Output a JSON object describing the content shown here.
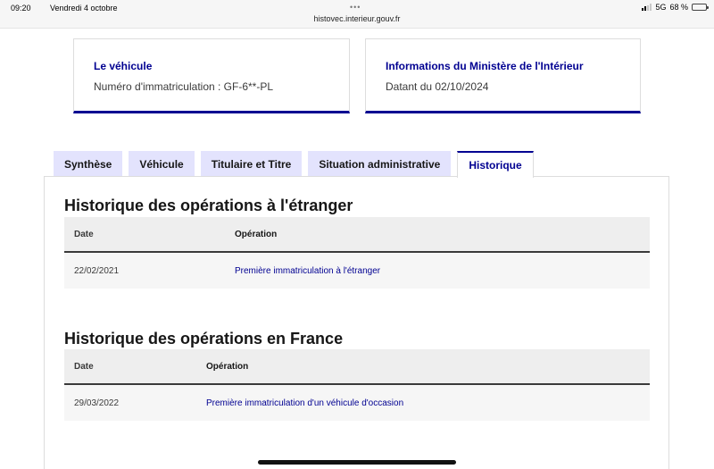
{
  "status_bar": {
    "time": "09:20",
    "date": "Vendredi 4 octobre",
    "dots": "•••",
    "url": "histovec.interieur.gouv.fr",
    "network": "5G",
    "battery": "68 %",
    "battery_level": 0.68
  },
  "cards": {
    "vehicle": {
      "title": "Le véhicule",
      "subtitle": "Numéro d'immatriculation : GF-6**-PL"
    },
    "ministry": {
      "title": "Informations du Ministère de l'Intérieur",
      "subtitle": "Datant du 02/10/2024"
    }
  },
  "tabs": [
    {
      "label": "Synthèse"
    },
    {
      "label": "Véhicule"
    },
    {
      "label": "Titulaire et Titre"
    },
    {
      "label": "Situation administrative"
    },
    {
      "label": "Historique",
      "active": true
    }
  ],
  "foreign_history": {
    "title": "Historique des opérations à l'étranger",
    "headers": {
      "date": "Date",
      "operation": "Opération"
    },
    "rows": [
      {
        "date": "22/02/2021",
        "operation": "Première immatriculation à l'étranger"
      }
    ]
  },
  "france_history": {
    "title": "Historique des opérations en France",
    "headers": {
      "date": "Date",
      "operation": "Opération"
    },
    "rows": [
      {
        "date": "29/03/2022",
        "operation": "Première immatriculation d'un véhicule d'occasion"
      }
    ]
  },
  "colors": {
    "accent": "#000091",
    "tab_bg": "#e3e3fd",
    "row_bg": "#f6f6f6",
    "header_bg": "#eeeeee"
  }
}
